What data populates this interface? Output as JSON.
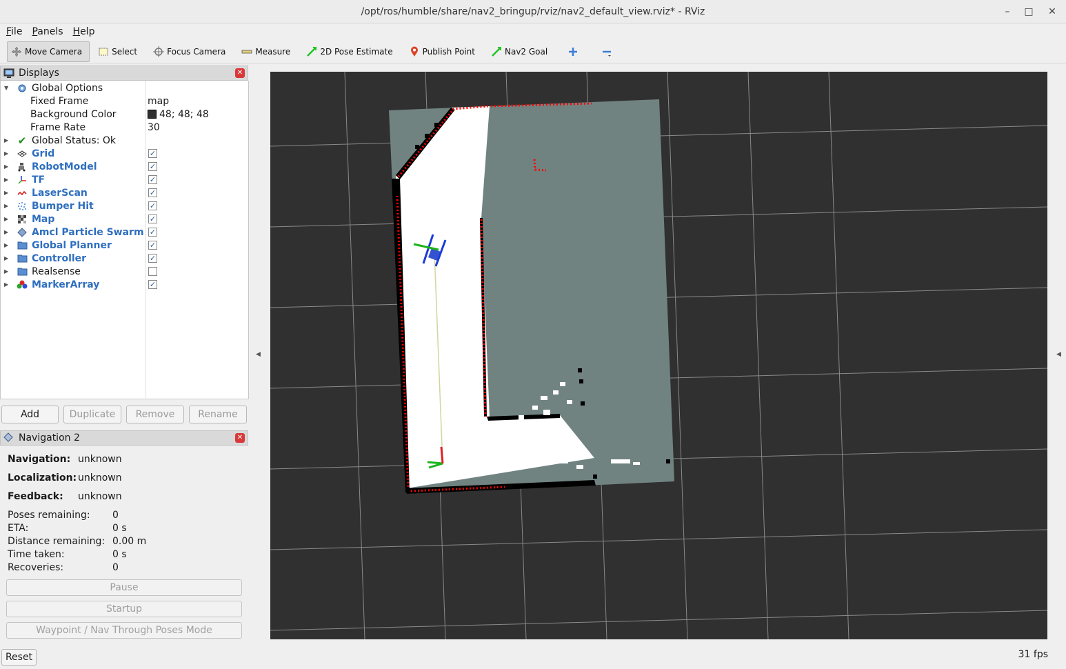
{
  "window": {
    "title": "/opt/ros/humble/share/nav2_bringup/rviz/nav2_default_view.rviz* - RViz",
    "minimize": "–",
    "maximize": "□",
    "close": "✕"
  },
  "menu": [
    "File",
    "Panels",
    "Help"
  ],
  "toolbar": [
    {
      "label": "Move Camera",
      "icon": "move-camera-icon",
      "active": true
    },
    {
      "label": "Select",
      "icon": "select-icon"
    },
    {
      "label": "Focus Camera",
      "icon": "focus-camera-icon"
    },
    {
      "label": "Measure",
      "icon": "measure-icon"
    },
    {
      "label": "2D Pose Estimate",
      "icon": "pose-estimate-icon"
    },
    {
      "label": "Publish Point",
      "icon": "publish-point-icon"
    },
    {
      "label": "Nav2 Goal",
      "icon": "nav2-goal-icon"
    },
    {
      "label": "",
      "icon": "add-tool-icon"
    },
    {
      "label": "",
      "icon": "remove-tool-icon"
    }
  ],
  "displays": {
    "title": "Displays",
    "global_options": "Global Options",
    "fixed_frame_label": "Fixed Frame",
    "fixed_frame": "map",
    "background_color_label": "Background Color",
    "background_color": "48; 48; 48",
    "frame_rate_label": "Frame Rate",
    "frame_rate": "30",
    "global_status": "Global Status: Ok",
    "items": [
      {
        "label": "Grid",
        "checked": true
      },
      {
        "label": "RobotModel",
        "checked": true
      },
      {
        "label": "TF",
        "checked": true
      },
      {
        "label": "LaserScan",
        "checked": true
      },
      {
        "label": "Bumper Hit",
        "checked": true
      },
      {
        "label": "Map",
        "checked": true
      },
      {
        "label": "Amcl Particle Swarm",
        "checked": true
      },
      {
        "label": "Global Planner",
        "checked": true
      },
      {
        "label": "Controller",
        "checked": true
      },
      {
        "label": "Realsense",
        "checked": false
      },
      {
        "label": "MarkerArray",
        "checked": true
      }
    ],
    "buttons": {
      "add": "Add",
      "duplicate": "Duplicate",
      "remove": "Remove",
      "rename": "Rename"
    }
  },
  "navigation": {
    "title": "Navigation 2",
    "navigation_label": "Navigation:",
    "navigation": "unknown",
    "localization_label": "Localization:",
    "localization": "unknown",
    "feedback_label": "Feedback:",
    "feedback": "unknown",
    "poses_remaining_label": "Poses remaining:",
    "poses_remaining": "0",
    "eta_label": "ETA:",
    "eta": "0 s",
    "distance_remaining_label": "Distance remaining:",
    "distance_remaining": "0.00 m",
    "time_taken_label": "Time taken:",
    "time_taken": "0 s",
    "recoveries_label": "Recoveries:",
    "recoveries": "0",
    "pause": "Pause",
    "startup": "Startup",
    "waypoint_mode": "Waypoint / Nav Through Poses Mode"
  },
  "status": {
    "reset": "Reset",
    "fps": "31 fps"
  },
  "colors": {
    "viewport_bg": "#303030",
    "map_unknown": "#708380",
    "map_free": "#ffffff",
    "map_occupied": "#000000",
    "laser": "#ff0000",
    "tree_blue": "#2f6fbf"
  }
}
